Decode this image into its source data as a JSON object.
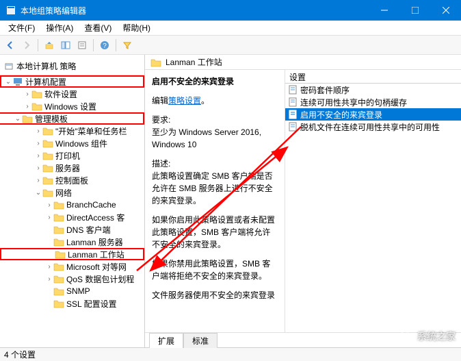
{
  "window": {
    "title": "本地组策略编辑器"
  },
  "menus": {
    "file": "文件(F)",
    "action": "操作(A)",
    "view": "查看(V)",
    "help": "帮助(H)"
  },
  "tree_header": "本地计算机 策略",
  "tree": {
    "computer_config": "计算机配置",
    "software_settings": "软件设置",
    "windows_settings": "Windows 设置",
    "admin_templates": "管理模板",
    "start_taskbar": "\"开始\"菜单和任务栏",
    "windows_components": "Windows 组件",
    "printers": "打印机",
    "server": "服务器",
    "control_panel": "控制面板",
    "network": "网络",
    "branchcache": "BranchCache",
    "directaccess": "DirectAccess 客",
    "dns_client": "DNS 客户端",
    "lanman_server": "Lanman 服务器",
    "lanman_workstation": "Lanman 工作站",
    "microsoft_peer": "Microsoft 对等网",
    "qos": "QoS 数据包计划程",
    "snmp": "SNMP",
    "ssl_config": "SSL 配置设置"
  },
  "main_header": "Lanman 工作站",
  "desc": {
    "title": "启用不安全的来宾登录",
    "edit_link_prefix": "编辑",
    "edit_link": "策略设置",
    "req_label": "要求:",
    "req_text": "至少为 Windows Server 2016, Windows 10",
    "desc_label": "描述:",
    "desc_p1": "此策略设置确定 SMB 客户端是否允许在 SMB 服务器上进行不安全的来宾登录。",
    "desc_p2": "如果你启用此策略设置或者未配置此策略设置，SMB 客户端将允许不安全的来宾登录。",
    "desc_p3": "如果你禁用此策略设置，SMB 客户端将拒绝不安全的来宾登录。",
    "desc_p4": "文件服务器使用不安全的来宾登录"
  },
  "list": {
    "col_header": "设置",
    "items": [
      "密码套件顺序",
      "连续可用性共享中的句柄缓存",
      "启用不安全的来宾登录",
      "脱机文件在连续可用性共享中的可用性"
    ]
  },
  "tabs": {
    "extended": "扩展",
    "standard": "标准"
  },
  "statusbar": "4 个设置",
  "watermark": "系统之家"
}
